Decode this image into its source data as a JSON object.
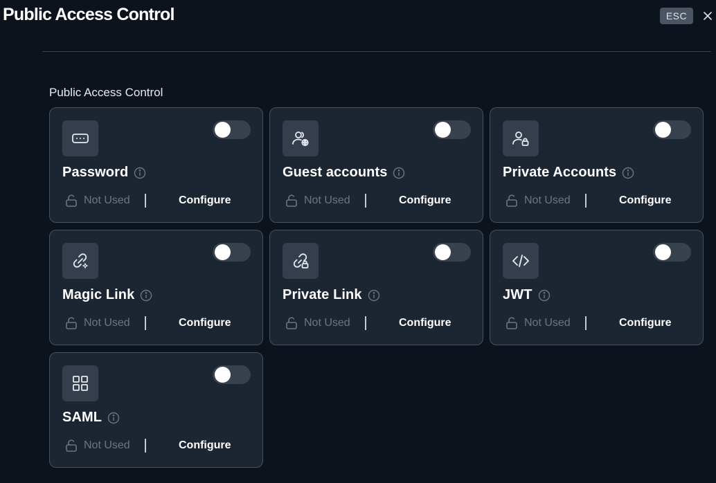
{
  "header": {
    "title": "Public Access Control",
    "esc_label": "ESC",
    "close_icon": "close-icon"
  },
  "section": {
    "title": "Public Access Control"
  },
  "cards": [
    {
      "id": "password",
      "title": "Password",
      "icon": "password-icon",
      "status": "Not Used",
      "action": "Configure",
      "enabled": false
    },
    {
      "id": "guest-accounts",
      "title": "Guest accounts",
      "icon": "guest-users-icon",
      "status": "Not Used",
      "action": "Configure",
      "enabled": false
    },
    {
      "id": "private-accounts",
      "title": "Private Accounts",
      "icon": "user-lock-icon",
      "status": "Not Used",
      "action": "Configure",
      "enabled": false
    },
    {
      "id": "magic-link",
      "title": "Magic Link",
      "icon": "magic-link-icon",
      "status": "Not Used",
      "action": "Configure",
      "enabled": false
    },
    {
      "id": "private-link",
      "title": "Private Link",
      "icon": "link-lock-icon",
      "status": "Not Used",
      "action": "Configure",
      "enabled": false
    },
    {
      "id": "jwt",
      "title": "JWT",
      "icon": "code-icon",
      "status": "Not Used",
      "action": "Configure",
      "enabled": false
    },
    {
      "id": "saml",
      "title": "SAML",
      "icon": "grid-icon",
      "status": "Not Used",
      "action": "Configure",
      "enabled": false
    }
  ]
}
